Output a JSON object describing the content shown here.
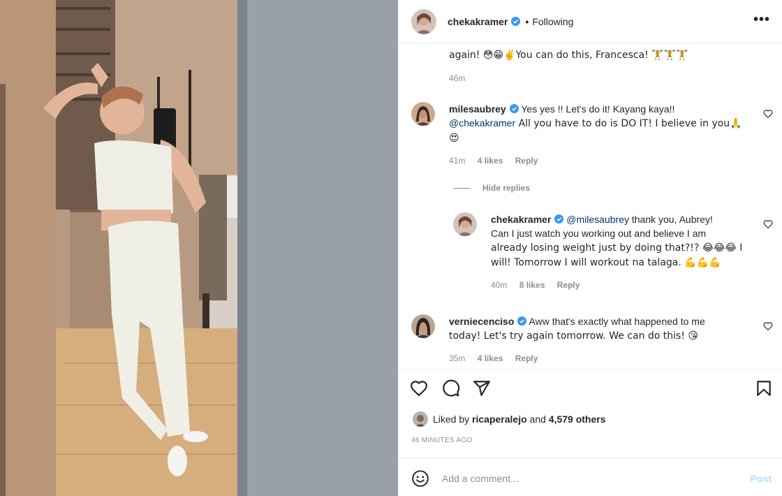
{
  "header": {
    "username": "chekakramer",
    "separator": "•",
    "following_label": "Following",
    "more_label": "•••"
  },
  "comments": {
    "partial": {
      "text_top": "",
      "text": "again! 😳😁✌️You can do this, Francesca! 🏋️🏋️🏋️",
      "time": "46m"
    },
    "items": [
      {
        "username": "milesaubrey",
        "line1": " Yes yes !! Let's do it! Kayang kaya!!",
        "mention": "@chekakramer",
        "line2": " All you have to do is DO IT! I believe in you🙏",
        "line3": "😍",
        "time": "41m",
        "likes": "4 likes",
        "reply": "Reply"
      },
      {
        "hide_replies": "Hide replies"
      },
      {
        "username": "chekakramer",
        "mention": "@milesaubrey",
        "line1": " thank you, Aubrey!",
        "line2": "Can I just watch you working out and believe I am",
        "line3": "already losing weight just by doing that?!? 😂😂😂 I",
        "line4": "will! Tomorrow I will workout na talaga. 💪💪💪",
        "time": "40m",
        "likes": "8 likes",
        "reply": "Reply"
      },
      {
        "username": "verniecenciso",
        "line1": " Aww that's exactly what happened to me",
        "line2": "today! Let's try again tomorrow. We can do this! 😘",
        "time": "35m",
        "likes": "4 likes",
        "reply": "Reply"
      }
    ]
  },
  "actions": {
    "icons": [
      "heart-icon",
      "comment-icon",
      "share-icon",
      "bookmark-icon"
    ],
    "liked_by_prefix": "Liked by ",
    "liked_by_user": "ricaperalejo",
    "liked_by_and": " and ",
    "liked_by_others": "4,579 others",
    "timestamp": "46 MINUTES AGO"
  },
  "add_comment": {
    "placeholder": "Add a comment...",
    "post_label": "Post"
  },
  "colors": {
    "verified": "#3897f0",
    "mention": "#00376b",
    "muted": "#8e8e8e",
    "post_disabled": "#b2dffc"
  }
}
